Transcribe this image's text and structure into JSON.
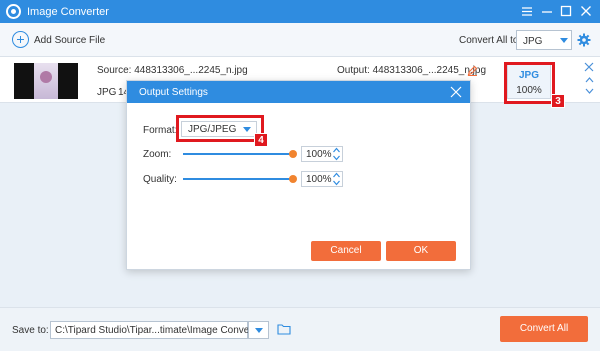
{
  "window": {
    "title": "Image Converter"
  },
  "toolbar": {
    "add_source_label": "Add Source File",
    "convert_all_label": "Convert All to:",
    "convert_all_value": "JPG"
  },
  "file": {
    "source": "Source: 448313306_...2245_n.jpg",
    "output": "Output: 448313306_...2245_n.jpg",
    "format": "JPG",
    "size": "14",
    "target_format": "JPG",
    "target_quality": "100%"
  },
  "dialog": {
    "title": "Output Settings",
    "format_label": "Format:",
    "format_value": "JPG/JPEG",
    "zoom_label": "Zoom:",
    "zoom_value": "100%",
    "zoom_fraction": 1.0,
    "quality_label": "Quality:",
    "quality_value": "100%",
    "quality_fraction": 1.0,
    "cancel_label": "Cancel",
    "ok_label": "OK"
  },
  "callouts": {
    "step3": "3",
    "step4": "4"
  },
  "footer": {
    "save_to_label": "Save to:",
    "save_path": "C:\\Tipard Studio\\Tipar...timate\\Image Converter",
    "convert_all_button": "Convert All"
  },
  "colors": {
    "accent": "#2f8ce0",
    "action": "#f26d3b",
    "callout": "#e0191f",
    "slider_knob": "#f1842f"
  }
}
